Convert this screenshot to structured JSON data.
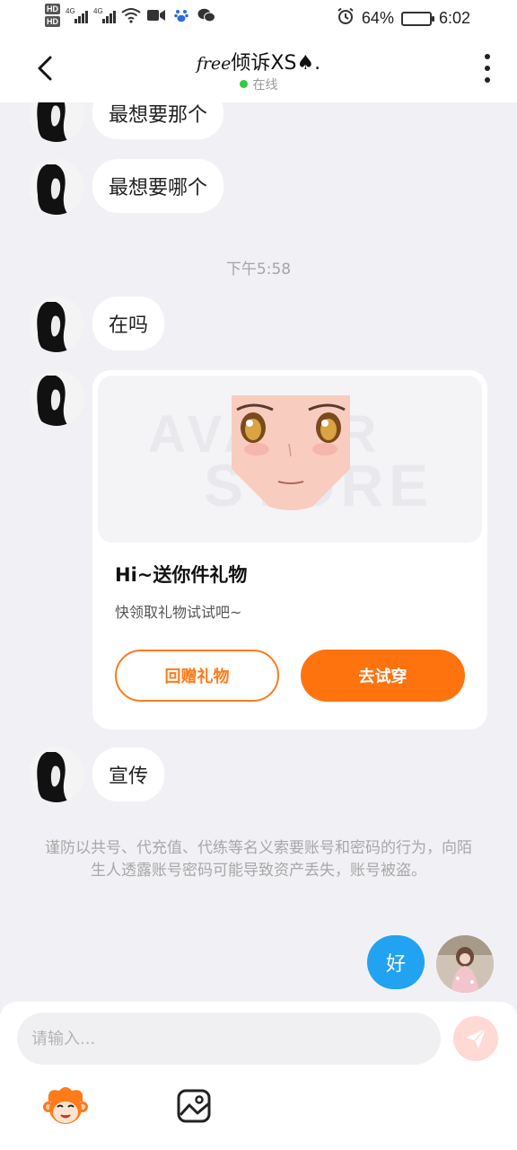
{
  "status_bar": {
    "hd_labels": [
      "HD",
      "HD"
    ],
    "network_labels": [
      "4G",
      "4G"
    ],
    "battery": "64%",
    "battery_level": 0.64,
    "time": "6:02",
    "icons": [
      "signal-icon",
      "wifi-icon",
      "video-icon",
      "baidu-icon",
      "wechat-icon",
      "alarm-icon",
      "battery-icon"
    ]
  },
  "header": {
    "title_script": "free",
    "title": "倾诉XS♠.",
    "status": "在线",
    "status_color": "#2ecc40"
  },
  "messages": [
    {
      "sender": "other",
      "text": "最想要那个"
    },
    {
      "sender": "other",
      "text": "最想要哪个"
    },
    {
      "type": "time",
      "text": "下午5:58"
    },
    {
      "sender": "other",
      "text": "在吗"
    },
    {
      "sender": "other",
      "type": "gift_card"
    },
    {
      "sender": "other",
      "text": "宣传"
    },
    {
      "sender": "me",
      "text": "好"
    }
  ],
  "gift_card": {
    "watermark_top": "AVATAR",
    "watermark_bottom": "STORE",
    "title": "Hi~送你件礼物",
    "subtitle": "快领取礼物试试吧~",
    "return_button": "回赠礼物",
    "try_button": "去试穿"
  },
  "warning": "谨防以共号、代充值、代练等名义索要账号和密码的行为，向陌生人透露账号密码可能导致资产丢失，账号被盗。",
  "composer": {
    "placeholder": "请输入..."
  },
  "colors": {
    "accent_orange": "#ff730f",
    "my_bubble_blue": "#21a3f2",
    "send_disabled": "#ffd9d4"
  }
}
